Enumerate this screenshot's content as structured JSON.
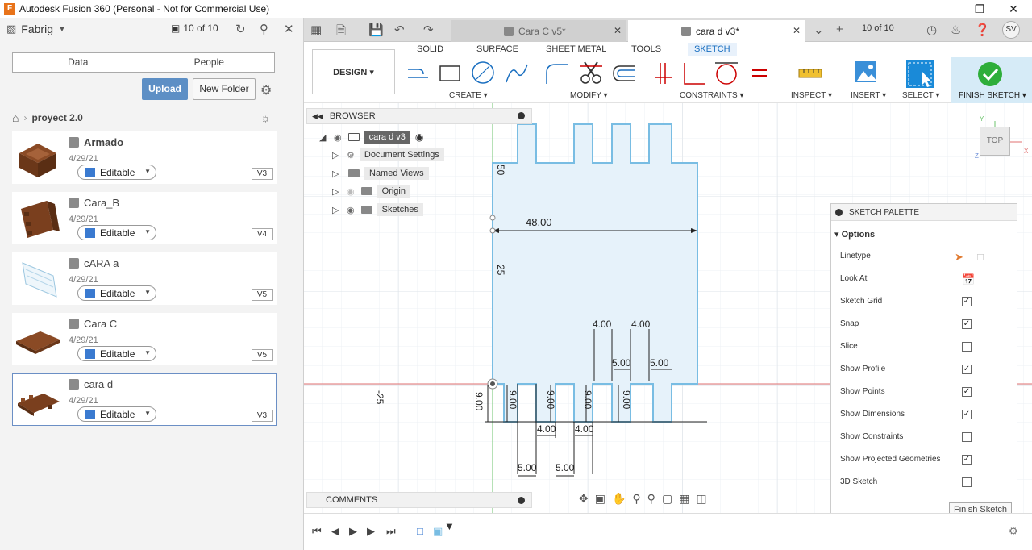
{
  "window": {
    "title": "Autodesk Fusion 360 (Personal - Not for Commercial Use)",
    "logo_letter": "F"
  },
  "datapanel": {
    "hub_name": "Fabrig",
    "count": "10 of 10",
    "tabs": [
      "Data",
      "People"
    ],
    "upload_label": "Upload",
    "new_folder_label": "New Folder",
    "project": "proyect 2.0",
    "items": [
      {
        "name": "Armado",
        "date": "4/29/21",
        "status": "Editable",
        "version": "V3"
      },
      {
        "name": "Cara_B",
        "date": "4/29/21",
        "status": "Editable",
        "version": "V4"
      },
      {
        "name": "cARA a",
        "date": "4/29/21",
        "status": "Editable",
        "version": "V5"
      },
      {
        "name": "Cara C",
        "date": "4/29/21",
        "status": "Editable",
        "version": "V5"
      },
      {
        "name": "cara d",
        "date": "4/29/21",
        "status": "Editable",
        "version": "V3"
      }
    ]
  },
  "tabstrip": {
    "tabs": [
      {
        "label": "Cara C v5*"
      },
      {
        "label": "cara d v3*"
      }
    ],
    "count": "10 of 10",
    "avatar": "SV"
  },
  "toolbar": {
    "workspace": "DESIGN",
    "ribbon_tabs": [
      "SOLID",
      "SURFACE",
      "SHEET METAL",
      "TOOLS",
      "SKETCH"
    ],
    "groups": [
      "CREATE",
      "MODIFY",
      "CONSTRAINTS",
      "INSPECT",
      "INSERT",
      "SELECT"
    ],
    "finish_label": "FINISH SKETCH"
  },
  "browser": {
    "title": "BROWSER",
    "root": "cara d v3",
    "nodes": [
      "Document Settings",
      "Named Views",
      "Origin",
      "Sketches"
    ]
  },
  "comments": {
    "title": "COMMENTS"
  },
  "viewcube": {
    "face": "TOP"
  },
  "dimensions": {
    "width_48": "48.00",
    "left_50": "50",
    "left_25": "25",
    "neg_25": "-25",
    "d4a": "4.00",
    "d4b": "4.00",
    "d5a": "5.00",
    "d5b": "5.00",
    "d9a": "9.00",
    "d9b": "9.00",
    "d9c": "9.00",
    "d9d": "9.00",
    "d9e": "9.00",
    "d4c": "4.00",
    "d4d": "4.00",
    "d5c": "5.00",
    "d5d": "5.00"
  },
  "palette": {
    "title": "SKETCH PALETTE",
    "section": "Options",
    "rows": [
      {
        "label": "Linetype",
        "kind": "icons"
      },
      {
        "label": "Look At",
        "kind": "icon"
      },
      {
        "label": "Sketch Grid",
        "checked": true
      },
      {
        "label": "Snap",
        "checked": true
      },
      {
        "label": "Slice",
        "checked": false
      },
      {
        "label": "Show Profile",
        "checked": true
      },
      {
        "label": "Show Points",
        "checked": true
      },
      {
        "label": "Show Dimensions",
        "checked": true
      },
      {
        "label": "Show Constraints",
        "checked": false
      },
      {
        "label": "Show Projected Geometries",
        "checked": true
      },
      {
        "label": "3D Sketch",
        "checked": false
      }
    ],
    "finish_button": "Finish Sketch"
  }
}
